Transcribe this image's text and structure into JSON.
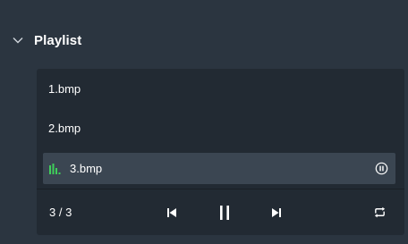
{
  "panel": {
    "title": "Playlist",
    "expanded": true,
    "icon": "chevron-down-icon"
  },
  "playlist": {
    "items": [
      {
        "name": "1.bmp",
        "active": false
      },
      {
        "name": "2.bmp",
        "active": false
      },
      {
        "name": "3.bmp",
        "active": true,
        "active_indicator_icon": "equalizer-icon",
        "action_icon": "pause-circle-icon"
      }
    ],
    "active_color": "#3fcf5a"
  },
  "player": {
    "counter": "3 / 3",
    "controls": [
      "previous-icon",
      "pause-icon",
      "next-icon",
      "repeat-icon"
    ]
  },
  "colors": {
    "background": "#2b3540",
    "list_background": "#222a33",
    "active_row": "#3b4652",
    "text": "#ffffff"
  }
}
